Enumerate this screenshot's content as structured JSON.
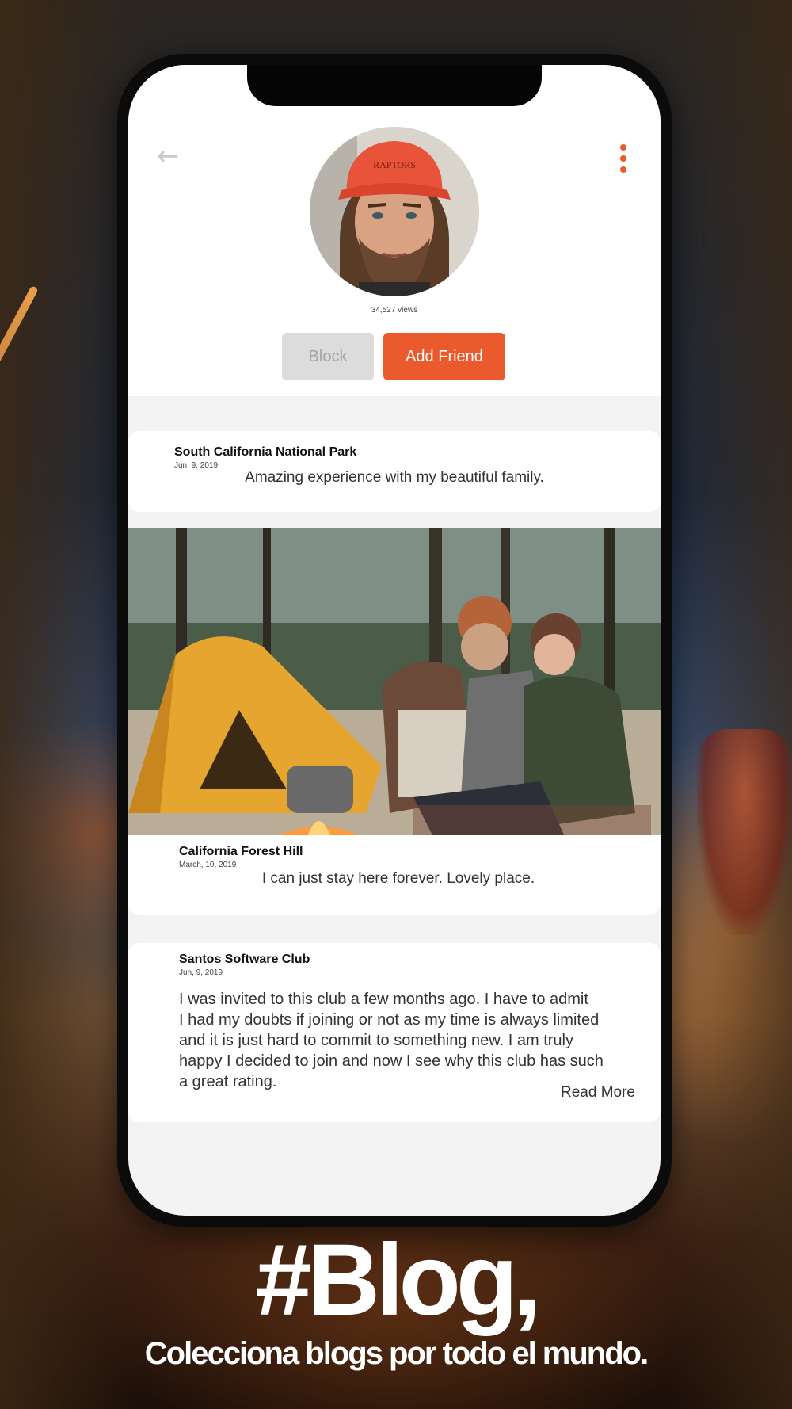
{
  "profile": {
    "views_count": "34,527",
    "views_label": "views",
    "block_label": "Block",
    "add_friend_label": "Add Friend"
  },
  "posts": [
    {
      "title": "South California National Park",
      "date": "Jun, 9, 2019",
      "text": "Amazing experience with my beautiful family."
    },
    {
      "title": "California Forest Hill",
      "date": "March, 10, 2019",
      "text": "I can just stay here forever. Lovely place."
    },
    {
      "title": "Santos Software Club",
      "date": "Jun, 9, 2019",
      "lines": [
        "I was invited to this club a few months ago. I have to admit",
        "I had my doubts if joining or not as my time is always limited",
        "and it is just hard to commit to something new. I am truly",
        "happy I decided to join and now I see why this club has such",
        "a great rating."
      ],
      "read_more": "Read More"
    }
  ],
  "footer": {
    "hashtag": "#Blog,",
    "tagline": "Colecciona blogs por todo el mundo."
  },
  "colors": {
    "accent": "#ea5a2c",
    "block_bg": "#dcdcdc",
    "screen_bg": "#f3f3f3"
  },
  "icons": {
    "back": "arrow-left-icon",
    "menu": "vertical-dots-icon"
  }
}
